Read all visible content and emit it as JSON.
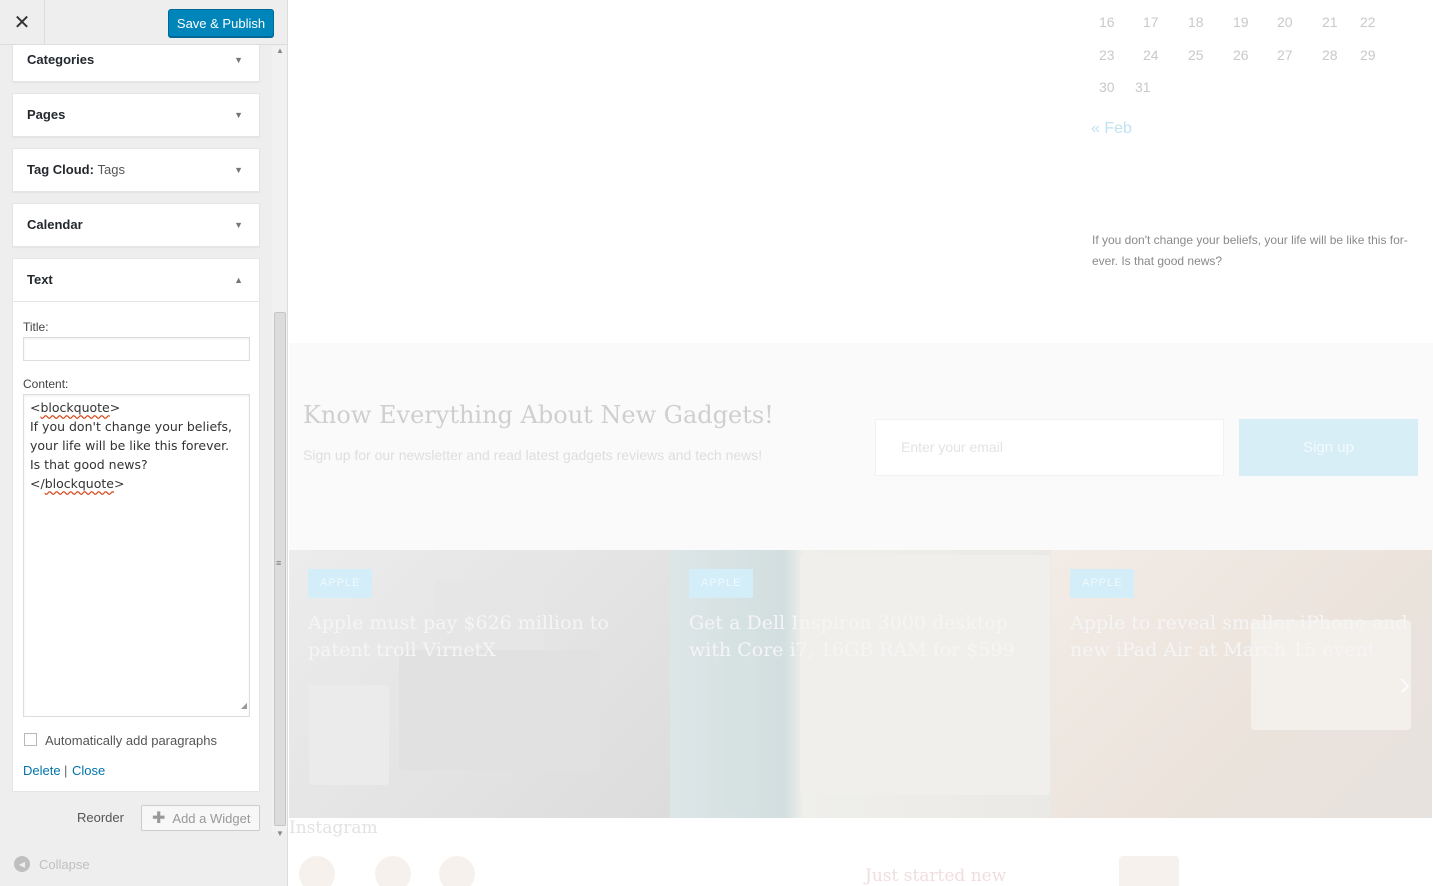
{
  "topbar": {
    "close_glyph": "✕",
    "publish_label": "Save & Publish"
  },
  "widgets": [
    {
      "title": "Categories",
      "subtitle": "",
      "arrow": "▼"
    },
    {
      "title": "Pages",
      "subtitle": "",
      "arrow": "▼"
    },
    {
      "title": "Tag Cloud:",
      "subtitle": "Tags",
      "arrow": "▼"
    },
    {
      "title": "Calendar",
      "subtitle": "",
      "arrow": "▼"
    }
  ],
  "text_widget": {
    "title": "Text",
    "arrow": "▲",
    "title_label": "Title:",
    "title_value": "",
    "content_label": "Content:",
    "content_lines": [
      "<blockquote>",
      "If you don't change your beliefs,",
      "your life will be like this forever.",
      "Is that good news?",
      "</blockquote>"
    ],
    "autop_label": "Automatically add paragraphs",
    "autop_checked": false,
    "delete_label": "Delete",
    "separator": "|",
    "close_label": "Close"
  },
  "footer": {
    "reorder_label": "Reorder",
    "add_widget_label": "Add a Widget",
    "collapse_label": "Collapse"
  },
  "preview": {
    "calendar": {
      "rows": [
        [
          "16",
          "17",
          "18",
          "19",
          "20",
          "21",
          "22"
        ],
        [
          "23",
          "24",
          "25",
          "26",
          "27",
          "28",
          "29"
        ],
        [
          "30",
          "31"
        ]
      ],
      "prev_link": "« Feb"
    },
    "quote": "If you don't change your beliefs, your life will be like this for-ever. Is that good news?",
    "newsletter": {
      "title": "Know Everything About New Gadgets!",
      "subtitle": "Sign up for our newsletter and read latest gadgets reviews and tech news!",
      "email_placeholder": "Enter your email",
      "button_label": "Sign up"
    },
    "slides": [
      {
        "tag": "APPLE",
        "title": "Apple must pay $626 million to patent troll VirnetX"
      },
      {
        "tag": "APPLE",
        "title": "Get a Dell Inspiron 3000 desktop with Core i7, 16GB RAM for $599"
      },
      {
        "tag": "APPLE",
        "title": "Apple to reveal smaller iPhone and new iPad Air at March 15 event"
      }
    ],
    "instagram_label": "Instagram",
    "ghost_text": "Just started new"
  }
}
